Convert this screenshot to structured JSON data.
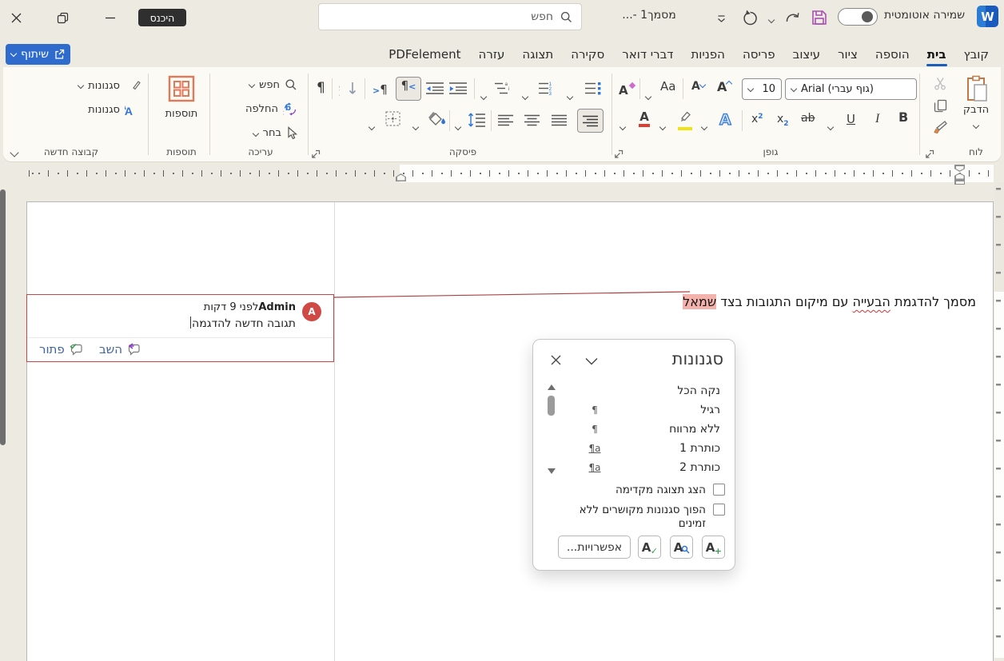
{
  "titlebar": {
    "signin": "היכנס",
    "search_placeholder": "חפש",
    "doc_title": "מסמך1 -...",
    "autosave_label": "שמירה אוטומטית",
    "logo_letter": "W"
  },
  "share": {
    "label": "שיתוף"
  },
  "tabs": {
    "items": [
      "קובץ",
      "בית",
      "הוספה",
      "ציור",
      "עיצוב",
      "פריסה",
      "הפניות",
      "דברי דואר",
      "סקירה",
      "תצוגה",
      "עזרה",
      "PDFelement"
    ],
    "active": "בית"
  },
  "ribbon": {
    "clipboard": {
      "label": "לוח",
      "paste": "הדבק"
    },
    "font": {
      "label": "גופן",
      "font_name": "Arial (גוף עברי)",
      "font_size": "10",
      "bold": "B",
      "italic": "I",
      "underline": "U",
      "strike": "ab",
      "sub": "x",
      "sup": "x",
      "effects": "A",
      "color": "A",
      "grow": "A",
      "shrink": "A",
      "case": "Aa",
      "clear": "A"
    },
    "paragraph": {
      "label": "פיסקה",
      "pilcrow": "¶"
    },
    "editing": {
      "label": "עריכה",
      "find": "חפש",
      "replace": "החלפה",
      "select": "בחר"
    },
    "addins": {
      "label": "תוספות",
      "button": "תוספות"
    },
    "new_group": {
      "label": "קבוצה חדשה",
      "styles_top": "סגנונות",
      "styles_bottom": "סגנונות"
    }
  },
  "comment": {
    "avatar": "A",
    "author": "Admin",
    "time": "לפני 9 דקות",
    "text": "תגובה חדשה להדגמה",
    "reply": "השב",
    "resolve": "פתור"
  },
  "document": {
    "t1": "מסמך להדגמת ",
    "misspelled": "הבעייה",
    "t2": " עם מיקום התגובות בצד ",
    "highlighted": "שמאל"
  },
  "styles_panel": {
    "title": "סגנונות",
    "items": [
      {
        "label": "נקה הכל",
        "marker": ""
      },
      {
        "label": "רגיל",
        "marker": "¶"
      },
      {
        "label": "ללא מרווח",
        "marker": "¶"
      },
      {
        "label": "כותרת 1",
        "marker": "¶a"
      },
      {
        "label": "כותרת 2",
        "marker": "¶a"
      }
    ],
    "preview_checkbox": "הצג תצוגה מקדימה",
    "disable_linked_checkbox": "הפוך סגנונות מקושרים ללא זמינים",
    "options": "אפשרויות...",
    "new_style_a": "A",
    "inspector_a": "A",
    "manage_a": "A"
  }
}
